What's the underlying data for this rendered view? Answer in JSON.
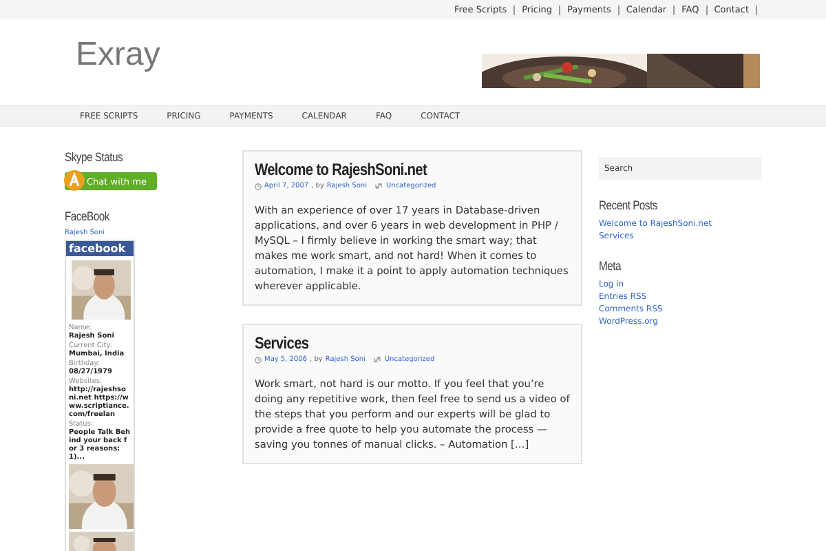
{
  "top_links": [
    "Free Scripts",
    "Pricing",
    "Payments",
    "Calendar",
    "FAQ",
    "Contact"
  ],
  "site_title": "Exray",
  "nav": [
    "FREE SCRIPTS",
    "PRICING",
    "PAYMENTS",
    "CALENDAR",
    "FAQ",
    "CONTACT"
  ],
  "left_sidebar": {
    "skype": {
      "title": "Skype Status",
      "button": "Chat with me"
    },
    "facebook": {
      "title": "FaceBook",
      "profile_link": "Rajesh Soni",
      "badge_title": "facebook",
      "fields": [
        {
          "label": "Name:",
          "value": "Rajesh Soni"
        },
        {
          "label": "Current City:",
          "value": "Mumbai, India"
        },
        {
          "label": "Birthday:",
          "value": "08/27/1979"
        },
        {
          "label": "Websites:",
          "value": "http://rajeshsoni.net https://www.scriptiance.com/freelan"
        },
        {
          "label": "Status:",
          "value": "People Talk Behind your back for 3 reasons: 1)..."
        }
      ]
    }
  },
  "posts": [
    {
      "title": "Welcome to RajeshSoni.net",
      "date": "April 7, 2007",
      "by": ", by",
      "author": "Rajesh Soni",
      "category": "Uncategorized",
      "body": "With an experience of over 17 years in Database-driven applications, and over 6 years in web development in PHP / MySQL – I firmly believe in working the smart way; that makes me work smart, and not hard!   When it comes to automation, I make it a point to apply automation techniques wherever applicable."
    },
    {
      "title": "Services",
      "date": "May 5, 2006",
      "by": ", by",
      "author": "Rajesh Soni",
      "category": "Uncategorized",
      "body": "Work smart, not hard is our motto. If you feel that you’re doing any repetitive work, then feel free to send us a video of the steps that you perform and our experts will be glad to provide a free quote to help you automate the process — saving you tonnes of manual clicks. – Automation […]"
    }
  ],
  "right_sidebar": {
    "search": {
      "placeholder": "Search"
    },
    "recent_posts": {
      "title": "Recent Posts",
      "links": [
        "Welcome to RajeshSoni.net",
        "Services"
      ]
    },
    "meta": {
      "title": "Meta",
      "links": [
        "Log in",
        "Entries RSS",
        "Comments RSS",
        "WordPress.org"
      ]
    }
  }
}
